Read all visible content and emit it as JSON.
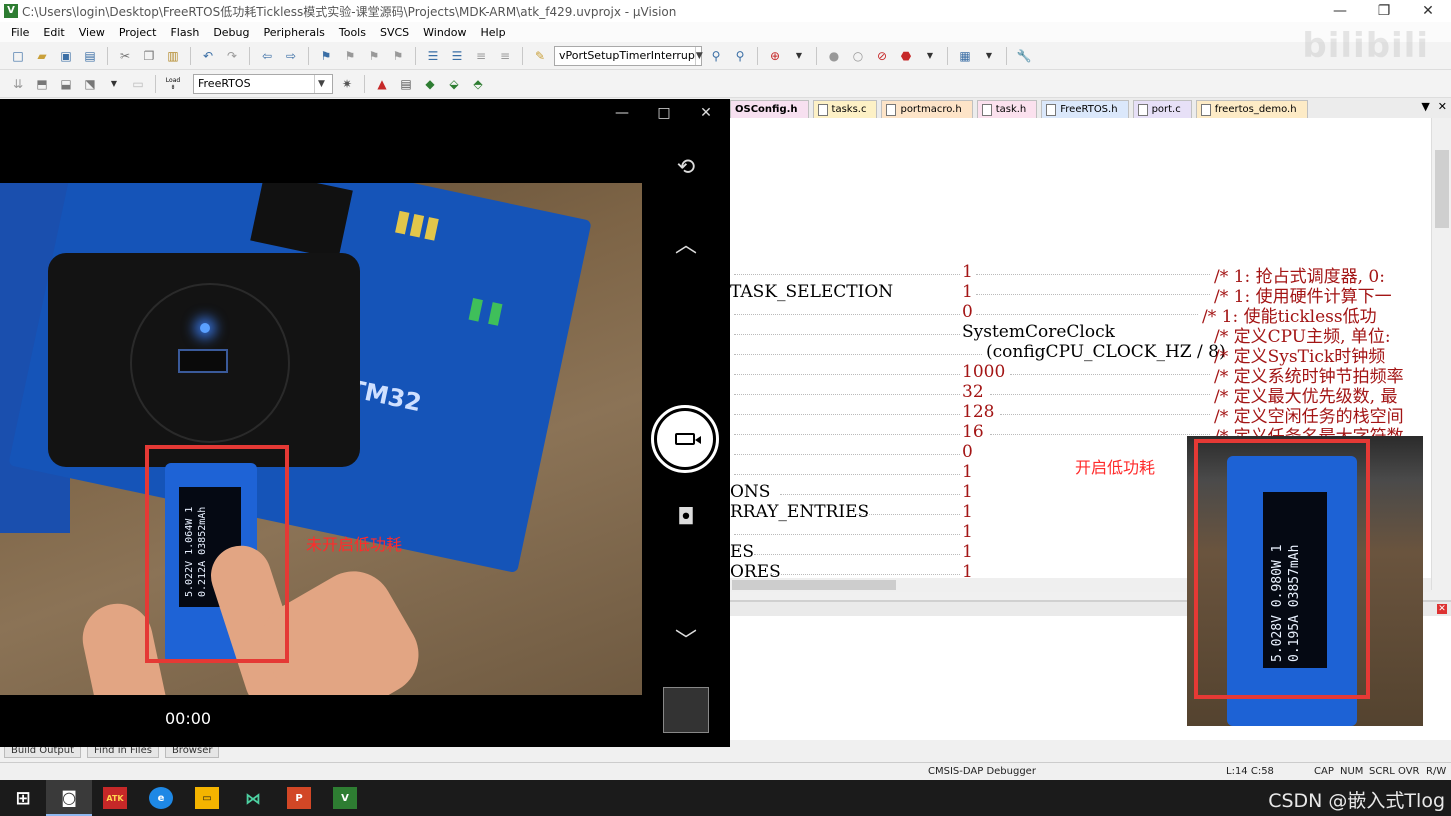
{
  "window": {
    "title": "C:\\Users\\login\\Desktop\\FreeRTOS低功耗Tickless模式实验-课堂源码\\Projects\\MDK-ARM\\atk_f429.uvprojx - µVision",
    "minimize": "—",
    "maximize": "❐",
    "close": "✕"
  },
  "menu": [
    "File",
    "Edit",
    "View",
    "Project",
    "Flash",
    "Debug",
    "Peripherals",
    "Tools",
    "SVCS",
    "Window",
    "Help"
  ],
  "toolbar": {
    "function_combo": "vPortSetupTimerInterrup",
    "target_combo": "FreeRTOS",
    "load_label": "Load"
  },
  "watermark": "bilibili",
  "tabs": [
    "OSConfig.h",
    "tasks.c",
    "portmacro.h",
    "task.h",
    "FreeRTOS.h",
    "port.c",
    "freertos_demo.h"
  ],
  "tab_colors": [
    "#f7e0f0",
    "#fdf1c6",
    "#fde4c8",
    "#fbe1ee",
    "#dbe8fb",
    "#e7e0f7",
    "#fdebc6"
  ],
  "code": [
    {
      "lhs": "",
      "val": "1",
      "cmt": "/* 1: 抢占式调度器, 0:"
    },
    {
      "lhs": "TASK_SELECTION",
      "val": "1",
      "cmt": "/* 1: 使用硬件计算下一"
    },
    {
      "lhs": "",
      "val": "0",
      "cmt": "/* 1: 使能tickless低功"
    },
    {
      "lhs": "",
      "val": "SystemCoreClock",
      "cmt": "/* 定义CPU主频, 单位:"
    },
    {
      "lhs": "",
      "val": "(configCPU_CLOCK_HZ / 8)",
      "cmt": "/* 定义SysTick时钟频"
    },
    {
      "lhs": "",
      "val": "1000",
      "cmt": "/* 定义系统时钟节拍频率"
    },
    {
      "lhs": "",
      "val": "32",
      "cmt": "/* 定义最大优先级数, 最"
    },
    {
      "lhs": "",
      "val": "128",
      "cmt": "/* 定义空闲任务的栈空间"
    },
    {
      "lhs": "",
      "val": "16",
      "cmt": "/* 定义任务名最大字符数"
    },
    {
      "lhs": "",
      "val": "0",
      "cmt": ""
    },
    {
      "lhs": "",
      "val": "1",
      "cmt": ""
    },
    {
      "lhs": "ONS",
      "val": "1",
      "cmt": ""
    },
    {
      "lhs": "RRAY_ENTRIES",
      "val": "1",
      "cmt": ""
    },
    {
      "lhs": "",
      "val": "1",
      "cmt": ""
    },
    {
      "lhs": "ES",
      "val": "1",
      "cmt": ""
    },
    {
      "lhs": "ORES",
      "val": "1",
      "cmt": ""
    }
  ],
  "bottom_tabs": [
    "Build Output",
    "Find in Files",
    "Browser"
  ],
  "status": {
    "debugger": "CMSIS-DAP Debugger",
    "position": "L:14 C:58",
    "caps": "CAP",
    "num": "NUM",
    "scrl": "SCRL",
    "ovr": "OVR",
    "rw": "R/W"
  },
  "camera": {
    "timer": "00:00",
    "label_off": "未开启低功耗",
    "meter_off": [
      "5.022V  1.064W 1",
      "0.212A  03852mAh"
    ]
  },
  "inset": {
    "label_on": "开启低功耗",
    "meter_on": [
      "5.028V  0.980W 1",
      "0.195A  03857mAh"
    ]
  },
  "board_text": "STM32",
  "taskbar": [
    "windows-start",
    "camera",
    "atk-xcom",
    "edge",
    "file-explorer",
    "visual-studio",
    "powerpoint",
    "keil-uvision"
  ],
  "csdn_watermark": "CSDN @嵌入式Tlog"
}
